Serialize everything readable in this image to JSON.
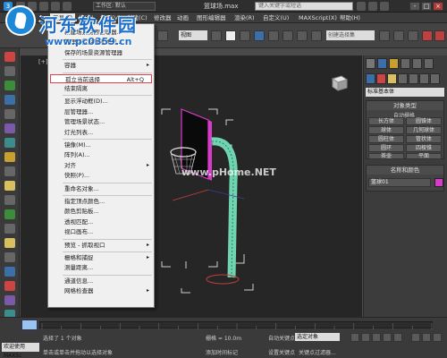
{
  "titlebar": {
    "workspace_label": "工作区: 默认",
    "file_title": "篮球场.max",
    "search_placeholder": "键入关键字或短语",
    "minimize": "-",
    "maximize": "□",
    "close": "×"
  },
  "menubar": {
    "items": [
      "工具(T)",
      "组(G)",
      "视图(V)",
      "创建(C)",
      "修改器",
      "动画",
      "图形编辑器",
      "渲染(R)",
      "自定义(U)",
      "MAXScript(X)",
      "帮助(H)"
    ]
  },
  "toolbar": {
    "view_dropdown": "视图",
    "selection_set_placeholder": "创建选择集"
  },
  "viewport": {
    "label": "[+]",
    "watermark": "www.pHome.NET"
  },
  "dropdown_menu": {
    "items": [
      {
        "label": "新建场景资源管理器...",
        "kind": "item"
      },
      {
        "label": "管理场景资源管理器...",
        "kind": "item"
      },
      {
        "label": "保存的场景资源管理器",
        "kind": "item"
      },
      {
        "label": "容器",
        "kind": "submenu"
      },
      {
        "label": "孤立当前选择",
        "shortcut": "Alt+Q",
        "kind": "highlight"
      },
      {
        "label": "结束隔离",
        "kind": "item"
      },
      {
        "label": "显示浮动框(D)...",
        "kind": "item"
      },
      {
        "label": "层管理器...",
        "kind": "item"
      },
      {
        "label": "管理场景状态...",
        "kind": "item"
      },
      {
        "label": "灯光列表...",
        "kind": "item"
      },
      {
        "label": "镜像(M)...",
        "kind": "item"
      },
      {
        "label": "阵列(A)...",
        "kind": "item"
      },
      {
        "label": "对齐",
        "kind": "submenu"
      },
      {
        "label": "快照(P)...",
        "kind": "item"
      },
      {
        "label": "重命名对象...",
        "kind": "item"
      },
      {
        "label": "指定顶点颜色...",
        "kind": "item"
      },
      {
        "label": "颜色剪贴板...",
        "kind": "item"
      },
      {
        "label": "透视匹配...",
        "kind": "item"
      },
      {
        "label": "视口画布...",
        "kind": "item"
      },
      {
        "label": "预览 - 抓取视口",
        "kind": "submenu"
      },
      {
        "label": "栅格和捕捉",
        "kind": "submenu"
      },
      {
        "label": "测量距离...",
        "kind": "item"
      },
      {
        "label": "通道信息...",
        "kind": "item"
      },
      {
        "label": "网格检查器",
        "kind": "submenu"
      }
    ]
  },
  "command_panel": {
    "category": "标准基本体",
    "object_type_title": "对象类型",
    "auto_grid": "自动栅格",
    "primitives": [
      "长方体",
      "圆锥体",
      "球体",
      "几何球体",
      "圆柱体",
      "管状体",
      "圆环",
      "四棱锥",
      "茶壶",
      "平面"
    ],
    "name_color_title": "名称和颜色",
    "object_name": "篮球01",
    "object_color": "#d63cc8"
  },
  "timeline": {
    "frame_label": "0 / 100"
  },
  "statusbar": {
    "welcome": "欢迎使用 MAXSc",
    "selected_text": "选择了 1 个对象",
    "hint_text": "单击或单击并拖动以选择对象",
    "grid_label": "栅格 = 10.0m",
    "auto_key": "自动关键点",
    "selected_object": "选定对象",
    "set_key": "设置关键点",
    "key_filter": "关键点过滤器...",
    "add_time_tag": "添加时间标记"
  },
  "overlay": {
    "site_name": "河东软件园",
    "site_url": "www.pc0359.cn"
  }
}
